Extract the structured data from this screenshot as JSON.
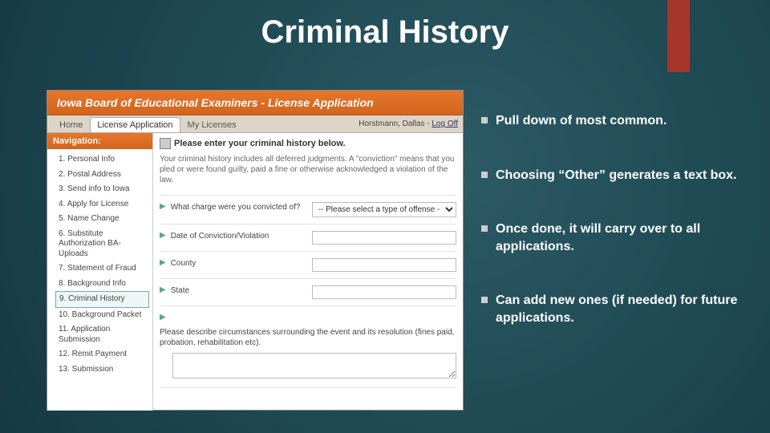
{
  "slide": {
    "title": "Criminal History"
  },
  "app": {
    "header": "Iowa Board of Educational Examiners - License Application",
    "tabs": {
      "home": "Home",
      "license_app": "License Application",
      "my_licenses": "My Licenses"
    },
    "user": {
      "name": "Horstmann, Dallas",
      "sep": " - ",
      "logoff": "Log Off"
    },
    "nav_title": "Navigation:",
    "nav_items": [
      "1. Personal Info",
      "2. Postal Address",
      "3. Send info to Iowa",
      "4. Apply for License",
      "5. Name Change",
      "6. Substitute Authorization BA-Uploads",
      "7. Statement of Fraud",
      "8. Background Info",
      "9. Criminal History",
      "10. Background Packet",
      "11. Application Submission",
      "12. Remit Payment",
      "13. Submission"
    ],
    "instruction": "Please enter your criminal history below.",
    "helptext": "Your criminal history includes all deferred judgments. A \"conviction\" means that you pled or were found guilty, paid a fine or otherwise acknowledged a violation of the law.",
    "fields": {
      "charge_label": "What charge were you convicted of?",
      "charge_placeholder": "-- Please select a type of offense --",
      "date_label": "Date of Conviction/Violation",
      "county_label": "County",
      "state_label": "State",
      "describe_label": "Please describe circumstances surrounding the event and its resolution (fines paid, probation, rehabilitation etc)."
    }
  },
  "bullets": [
    "Pull down of most common.",
    "Choosing “Other” generates a text box.",
    "Once done, it will carry over to all applications.",
    "Can add new ones (if needed) for future applications."
  ]
}
